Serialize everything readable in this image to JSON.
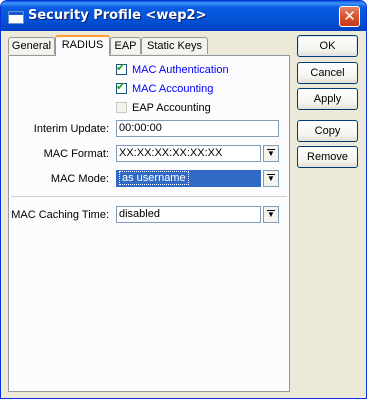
{
  "window": {
    "title": "Security Profile <wep2>",
    "close_symbol": "✕"
  },
  "tabs": [
    {
      "label": "General",
      "active": false
    },
    {
      "label": "RADIUS",
      "active": true
    },
    {
      "label": "EAP",
      "active": false
    },
    {
      "label": "Static Keys",
      "active": false
    }
  ],
  "checkboxes": {
    "mac_auth": {
      "label": "MAC Authentication",
      "checked": true,
      "enabled": true
    },
    "mac_accounting": {
      "label": "MAC Accounting",
      "checked": true,
      "enabled": true
    },
    "eap_accounting": {
      "label": "EAP Accounting",
      "checked": false,
      "enabled": false
    }
  },
  "fields": {
    "interim_update": {
      "label": "Interim Update:",
      "value": "00:00:00"
    },
    "mac_format": {
      "label": "MAC Format:",
      "value": "XX:XX:XX:XX:XX:XX"
    },
    "mac_mode": {
      "label": "MAC Mode:",
      "value": "as username"
    },
    "mac_caching_time": {
      "label": "MAC Caching Time:",
      "value": "disabled"
    }
  },
  "buttons": {
    "ok": "OK",
    "cancel": "Cancel",
    "apply": "Apply",
    "copy": "Copy",
    "remove": "Remove"
  },
  "icons": {
    "check_mark": "✔",
    "dropdown_arrow": "▼"
  }
}
